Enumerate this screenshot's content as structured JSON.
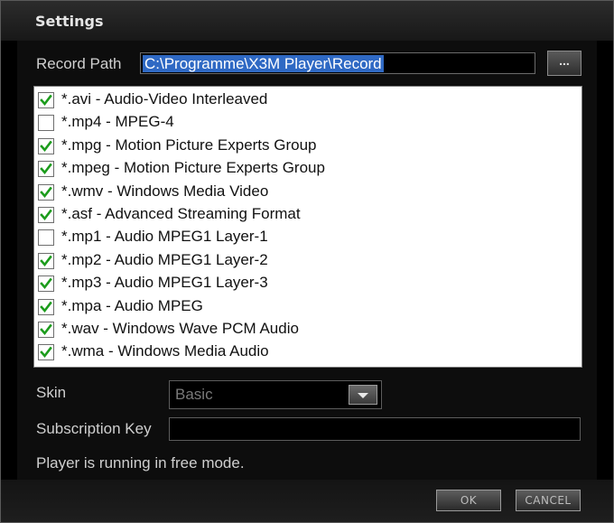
{
  "window": {
    "title": "Settings"
  },
  "record_path": {
    "label": "Record Path",
    "value": "C:\\Programme\\X3M Player\\Record",
    "browse_label": "..."
  },
  "file_types": [
    {
      "label": "*.avi - Audio-Video Interleaved",
      "checked": true
    },
    {
      "label": "*.mp4 - MPEG-4",
      "checked": false
    },
    {
      "label": "*.mpg - Motion Picture Experts Group",
      "checked": true
    },
    {
      "label": "*.mpeg - Motion Picture Experts Group",
      "checked": true
    },
    {
      "label": "*.wmv - Windows Media Video",
      "checked": true
    },
    {
      "label": "*.asf - Advanced Streaming Format",
      "checked": true
    },
    {
      "label": "*.mp1 - Audio MPEG1 Layer-1",
      "checked": false
    },
    {
      "label": "*.mp2 - Audio MPEG1 Layer-2",
      "checked": true
    },
    {
      "label": "*.mp3 - Audio MPEG1 Layer-3",
      "checked": true
    },
    {
      "label": "*.mpa - Audio MPEG",
      "checked": true
    },
    {
      "label": "*.wav - Windows Wave PCM Audio",
      "checked": true
    },
    {
      "label": "*.wma - Windows Media Audio",
      "checked": true
    }
  ],
  "skin": {
    "label": "Skin",
    "selected": "Basic",
    "arrow_icon": "chevron-down-icon"
  },
  "subscription": {
    "label": "Subscription Key",
    "value": ""
  },
  "status": {
    "text": "Player is running in free mode."
  },
  "buttons": {
    "ok": "OK",
    "cancel": "CANCEL"
  },
  "colors": {
    "check": "#1c9c1c",
    "selection": "#2f69c4"
  }
}
